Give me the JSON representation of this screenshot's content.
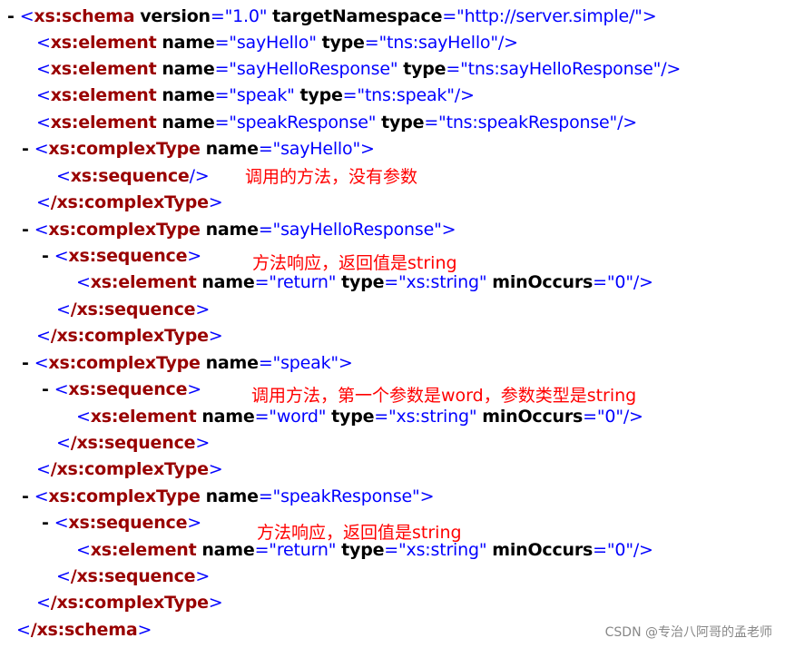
{
  "xml_lines": [
    {
      "toggle": "-",
      "tag": "xs:schema",
      "attrs": [
        {
          "name": "version",
          "value": "1.0"
        },
        {
          "name": "targetNamespace",
          "value": "http://server.simple/"
        }
      ],
      "close": ">"
    },
    {
      "toggle": "",
      "tag": "xs:element",
      "attrs": [
        {
          "name": "name",
          "value": "sayHello"
        },
        {
          "name": "type",
          "value": "tns:sayHello"
        }
      ],
      "close": "/>"
    },
    {
      "toggle": "",
      "tag": "xs:element",
      "attrs": [
        {
          "name": "name",
          "value": "sayHelloResponse"
        },
        {
          "name": "type",
          "value": "tns:sayHelloResponse"
        }
      ],
      "close": "/>"
    },
    {
      "toggle": "",
      "tag": "xs:element",
      "attrs": [
        {
          "name": "name",
          "value": "speak"
        },
        {
          "name": "type",
          "value": "tns:speak"
        }
      ],
      "close": "/>"
    },
    {
      "toggle": "",
      "tag": "xs:element",
      "attrs": [
        {
          "name": "name",
          "value": "speakResponse"
        },
        {
          "name": "type",
          "value": "tns:speakResponse"
        }
      ],
      "close": "/>"
    },
    {
      "toggle": "-",
      "tag": "xs:complexType",
      "attrs": [
        {
          "name": "name",
          "value": "sayHello"
        }
      ],
      "close": ">"
    },
    {
      "toggle": "",
      "tag": "xs:sequence",
      "attrs": [],
      "close": "/>"
    },
    {
      "toggle": "",
      "tag": "/xs:complexType",
      "attrs": [],
      "close": ">"
    },
    {
      "toggle": "-",
      "tag": "xs:complexType",
      "attrs": [
        {
          "name": "name",
          "value": "sayHelloResponse"
        }
      ],
      "close": ">"
    },
    {
      "toggle": "-",
      "tag": "xs:sequence",
      "attrs": [],
      "close": ">"
    },
    {
      "toggle": "",
      "tag": "xs:element",
      "attrs": [
        {
          "name": "name",
          "value": "return"
        },
        {
          "name": "type",
          "value": "xs:string"
        },
        {
          "name": "minOccurs",
          "value": "0"
        }
      ],
      "close": "/>"
    },
    {
      "toggle": "",
      "tag": "/xs:sequence",
      "attrs": [],
      "close": ">"
    },
    {
      "toggle": "",
      "tag": "/xs:complexType",
      "attrs": [],
      "close": ">"
    },
    {
      "toggle": "-",
      "tag": "xs:complexType",
      "attrs": [
        {
          "name": "name",
          "value": "speak"
        }
      ],
      "close": ">"
    },
    {
      "toggle": "-",
      "tag": "xs:sequence",
      "attrs": [],
      "close": ">"
    },
    {
      "toggle": "",
      "tag": "xs:element",
      "attrs": [
        {
          "name": "name",
          "value": "word"
        },
        {
          "name": "type",
          "value": "xs:string"
        },
        {
          "name": "minOccurs",
          "value": "0"
        }
      ],
      "close": "/>"
    },
    {
      "toggle": "",
      "tag": "/xs:sequence",
      "attrs": [],
      "close": ">"
    },
    {
      "toggle": "",
      "tag": "/xs:complexType",
      "attrs": [],
      "close": ">"
    },
    {
      "toggle": "-",
      "tag": "xs:complexType",
      "attrs": [
        {
          "name": "name",
          "value": "speakResponse"
        }
      ],
      "close": ">"
    },
    {
      "toggle": "-",
      "tag": "xs:sequence",
      "attrs": [],
      "close": ">"
    },
    {
      "toggle": "",
      "tag": "xs:element",
      "attrs": [
        {
          "name": "name",
          "value": "return"
        },
        {
          "name": "type",
          "value": "xs:string"
        },
        {
          "name": "minOccurs",
          "value": "0"
        }
      ],
      "close": "/>"
    },
    {
      "toggle": "",
      "tag": "/xs:sequence",
      "attrs": [],
      "close": ">"
    },
    {
      "toggle": "",
      "tag": "/xs:complexType",
      "attrs": [],
      "close": ">"
    },
    {
      "toggle": "",
      "tag": "/xs:schema",
      "attrs": [],
      "close": ">"
    }
  ],
  "annotations": {
    "say_hello": "调用的方法，没有参数",
    "say_hello_response": "方法响应，返回值是string",
    "speak": "调用方法，第一个参数是word，参数类型是string",
    "speak_response": "方法响应，返回值是string"
  },
  "watermark": "CSDN @专治八阿哥的孟老师",
  "colors": {
    "tag": "#990000",
    "attribute_value": "#0000ff",
    "annotation": "#ff0000"
  }
}
